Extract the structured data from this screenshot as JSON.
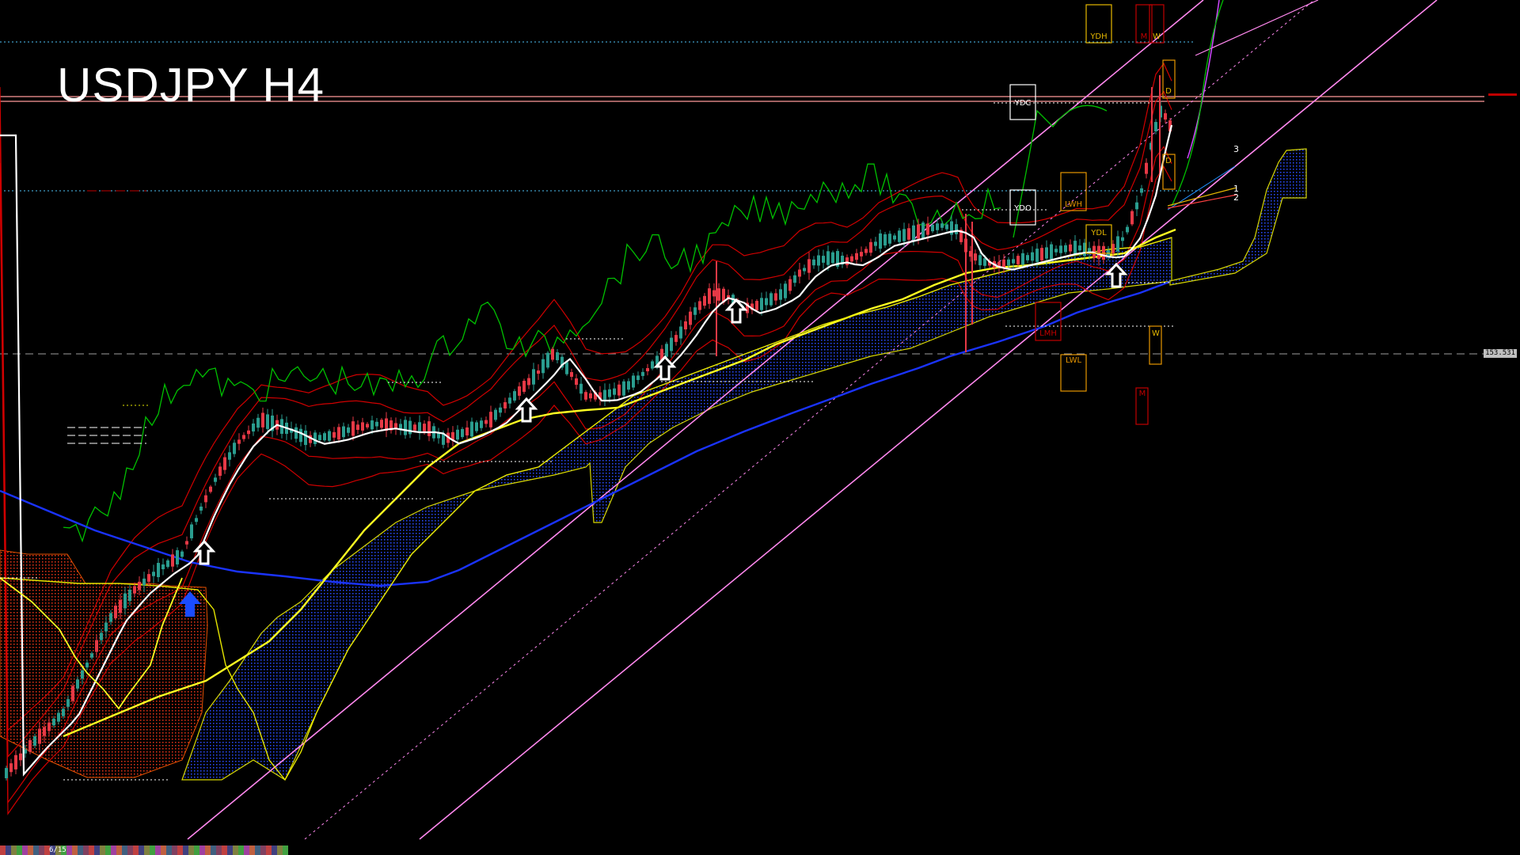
{
  "chart_title": "USDJPY H4",
  "price_tag_mid": "153.531",
  "price_tag_top": "",
  "date_label": "6/15",
  "chart_data": {
    "type": "line",
    "symbol": "USDJPY",
    "timeframe": "H4",
    "theme": {
      "background": "#000000",
      "bull": "#2a9d8f",
      "bear": "#e63946"
    },
    "level_labels": [
      "YDH",
      "YDC",
      "YDO",
      "YDL",
      "LWH",
      "LWL",
      "LMH",
      "M",
      "W",
      "D"
    ],
    "channel_labels": [
      "1",
      "2",
      "3"
    ],
    "horizontal_levels": [
      {
        "name": "YDH",
        "style": "dotted",
        "color": "#4fc3f7"
      },
      {
        "name": "YDC",
        "style": "solid",
        "color": "#ff9999"
      },
      {
        "name": "YDO",
        "style": "dotted",
        "color": "#4fc3f7"
      },
      {
        "name": "mid",
        "style": "dashed",
        "color": "#9e9e9e"
      }
    ],
    "series": [
      {
        "name": "",
        "color": "#ffffff"
      },
      {
        "name": "",
        "color": "#ffff00"
      },
      {
        "name": "",
        "color": "#1a33ff"
      },
      {
        "name": "",
        "color": "#00c000"
      },
      {
        "name": "",
        "color": "#ff66ff"
      }
    ]
  }
}
